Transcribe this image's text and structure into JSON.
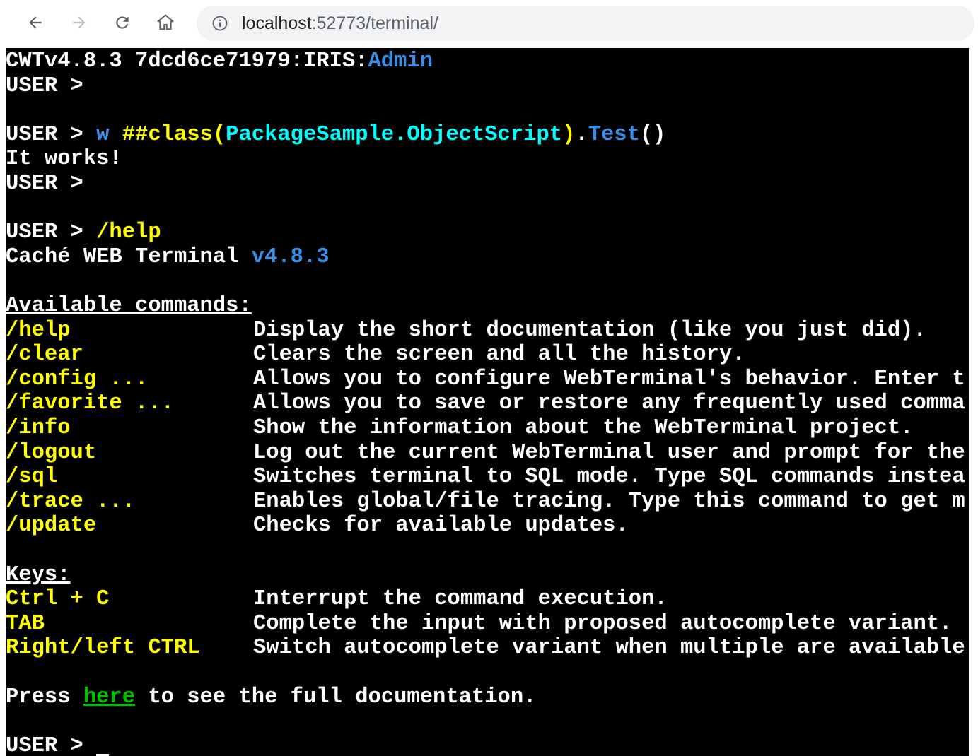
{
  "browser": {
    "url_host": "localhost",
    "url_path": ":52773/terminal/",
    "icons": [
      "back-icon",
      "forward-icon",
      "reload-icon",
      "home-icon",
      "info-icon"
    ]
  },
  "colors": {
    "background": "#000000",
    "text": "#ffffff",
    "command": "#ffff00",
    "keyword": "#3a8ee6",
    "class_name": "#00ffff",
    "link": "#00c000"
  },
  "terminal": {
    "header_prefix": "CWTv4.8.3 7dcd6ce71979:IRIS:",
    "header_namespace": "Admin",
    "prompt": "USER > ",
    "cmd1_w": "w ",
    "cmd1_hash": "##class",
    "cmd1_paren_open": "(",
    "cmd1_class": "PackageSample.ObjectScript",
    "cmd1_paren_close": ")",
    "cmd1_dot": ".",
    "cmd1_method": "Test",
    "cmd1_args": "()",
    "output1": "It works!",
    "cmd2": "/help",
    "title": "Caché WEB Terminal ",
    "version": "v4.8.3",
    "commands_heading": "Available commands:",
    "commands": [
      {
        "name": "/help",
        "desc": "Display the short documentation (like you just did)."
      },
      {
        "name": "/clear",
        "desc": "Clears the screen and all the history."
      },
      {
        "name": "/config ...",
        "desc": "Allows you to configure WebTerminal's behavior. Enter t"
      },
      {
        "name": "/favorite ...",
        "desc": "Allows you to save or restore any frequently used comma"
      },
      {
        "name": "/info",
        "desc": "Show the information about the WebTerminal project."
      },
      {
        "name": "/logout",
        "desc": "Log out the current WebTerminal user and prompt for the"
      },
      {
        "name": "/sql",
        "desc": "Switches terminal to SQL mode. Type SQL commands instea"
      },
      {
        "name": "/trace ...",
        "desc": "Enables global/file tracing. Type this command to get m"
      },
      {
        "name": "/update",
        "desc": "Checks for available updates."
      }
    ],
    "keys_heading": "Keys:",
    "keys": [
      {
        "name": "Ctrl + C",
        "desc": "Interrupt the command execution."
      },
      {
        "name": "TAB",
        "desc": "Complete the input with proposed autocomplete variant."
      },
      {
        "name": "Right/left CTRL",
        "desc": "Switch autocomplete variant when multiple are available"
      }
    ],
    "press_prefix": "Press ",
    "press_link": "here",
    "press_suffix": " to see the full documentation."
  }
}
